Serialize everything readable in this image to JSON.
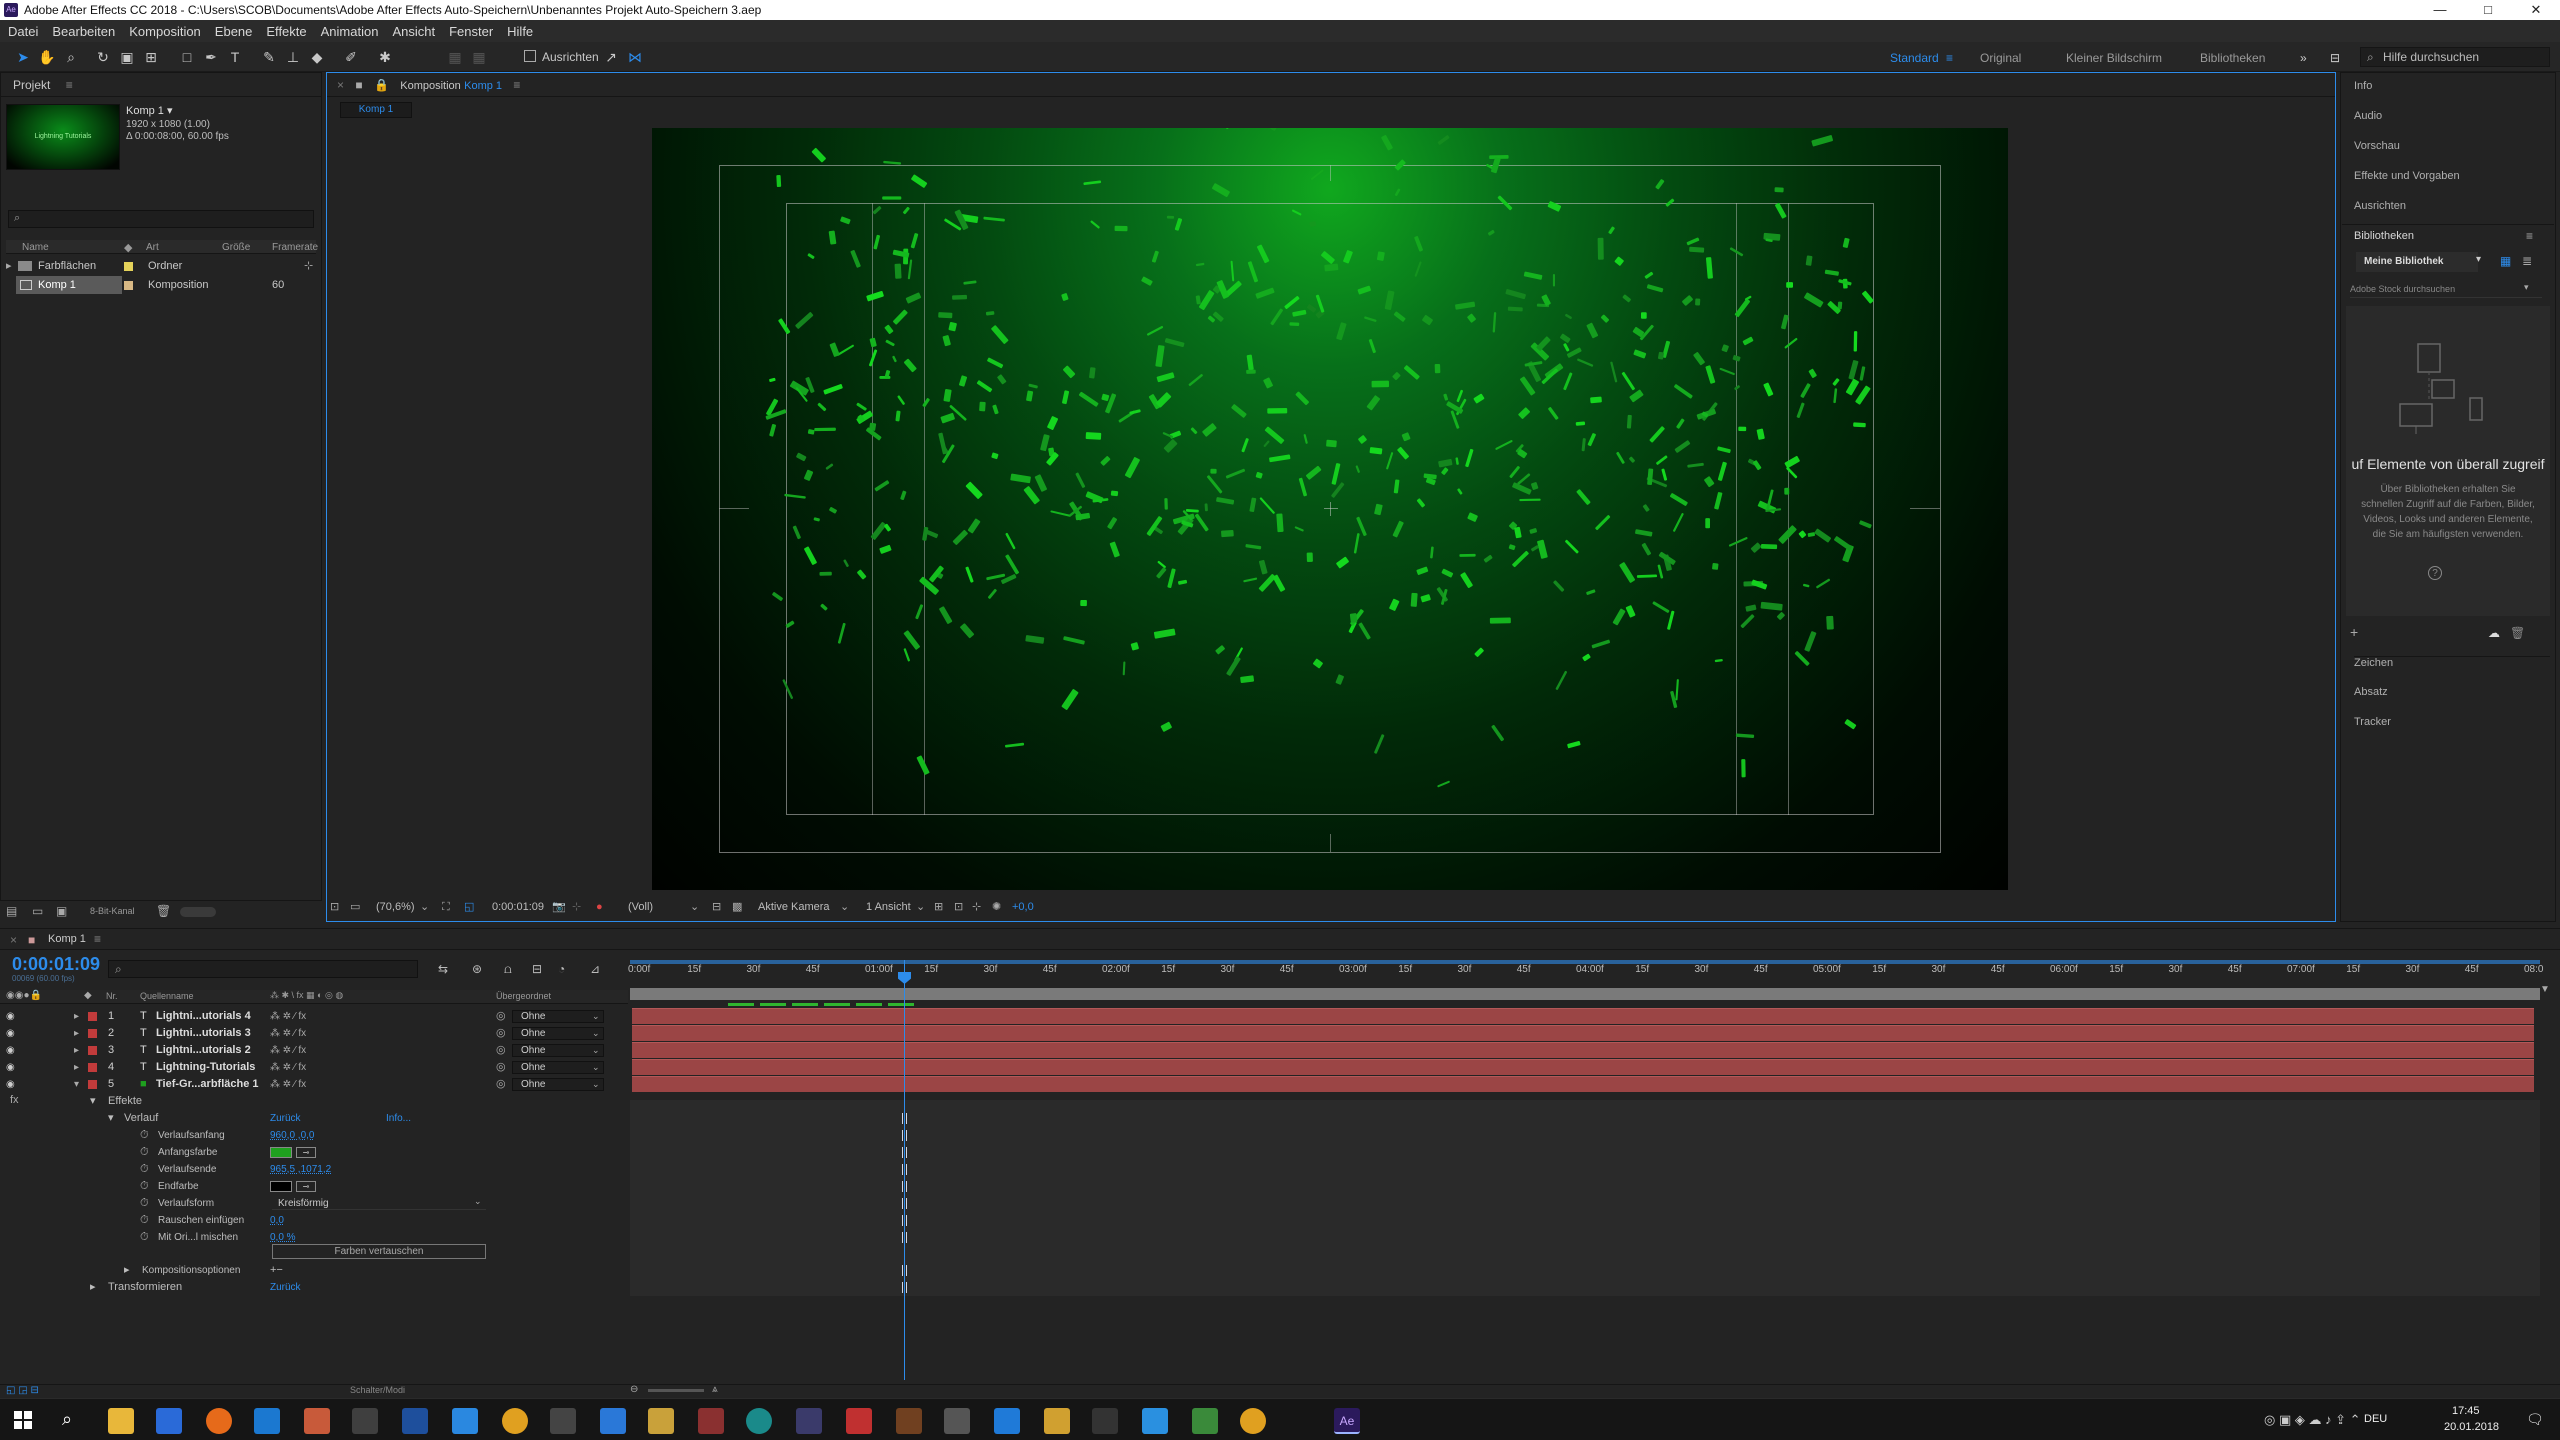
{
  "window": {
    "title": "Adobe After Effects CC 2018 - C:\\Users\\SCOB\\Documents\\Adobe After Effects Auto-Speichern\\Unbenanntes Projekt Auto-Speichern 3.aep",
    "minimize": "—",
    "maximize": "□",
    "close": "✕"
  },
  "menu": [
    "Datei",
    "Bearbeiten",
    "Komposition",
    "Ebene",
    "Effekte",
    "Animation",
    "Ansicht",
    "Fenster",
    "Hilfe"
  ],
  "toolbar": {
    "align_label": "Ausrichten",
    "workspaces": [
      "Standard",
      "Original",
      "Kleiner Bildschirm",
      "Bibliotheken"
    ],
    "active_workspace": "Standard",
    "help_placeholder": "Hilfe durchsuchen"
  },
  "project": {
    "tab": "Projekt",
    "thumb_text": "Lightning Tutorials",
    "comp_name": "Komp 1 ▾",
    "comp_size": "1920 x 1080 (1.00)",
    "comp_duration": "Δ 0:00:08:00, 60.00 fps",
    "columns": [
      "Name",
      "Art",
      "Größe",
      "Framerate"
    ],
    "items": [
      {
        "name": "Farbflächen",
        "type": "Ordner",
        "size": "",
        "fps": ""
      },
      {
        "name": "Komp 1",
        "type": "Komposition",
        "size": "",
        "fps": "60"
      }
    ],
    "footer_bpc": "8-Bit-Kanal"
  },
  "composition": {
    "tab_prefix": "Komposition",
    "tab_name": "Komp 1",
    "sub_tab": "Komp 1",
    "zoom": "(70,6%)",
    "timecode": "0:00:01:09",
    "quality": "(Voll)",
    "camera": "Aktive Kamera",
    "views": "1 Ansicht",
    "exposure": "+0,0"
  },
  "right_panel": {
    "items_top": [
      "Info",
      "Audio",
      "Vorschau",
      "Effekte und Vorgaben",
      "Ausrichten"
    ],
    "libraries_title": "Bibliotheken",
    "library_name": "Meine Bibliothek",
    "stock_search": "Adobe Stock durchsuchen",
    "promo_title": "uf Elemente von überall zugreif",
    "promo_text": "Über Bibliotheken erhalten Sie schnellen Zugriff auf die Farben, Bilder, Videos, Looks und anderen Elemente, die Sie am häufigsten verwenden.",
    "items_bottom": [
      "Zeichen",
      "Absatz",
      "Tracker"
    ]
  },
  "timeline": {
    "tab": "Komp 1",
    "timecode": "0:00:01:09",
    "frame_info": "00069 (60.00 fps)",
    "col_nr": "Nr.",
    "col_source": "Quellenname",
    "col_parent": "Übergeordnet",
    "ruler": [
      "0:00f",
      "15f",
      "30f",
      "45f",
      "01:00f",
      "15f",
      "30f",
      "45f",
      "02:00f",
      "15f",
      "30f",
      "45f",
      "03:00f",
      "15f",
      "30f",
      "45f",
      "04:00f",
      "15f",
      "30f",
      "45f",
      "05:00f",
      "15f",
      "30f",
      "45f",
      "06:00f",
      "15f",
      "30f",
      "45f",
      "07:00f",
      "15f",
      "30f",
      "45f",
      "08:0"
    ],
    "layers": [
      {
        "nr": "1",
        "type": "T",
        "name": "Lightni...utorials 4",
        "parent": "Ohne"
      },
      {
        "nr": "2",
        "type": "T",
        "name": "Lightni...utorials 3",
        "parent": "Ohne"
      },
      {
        "nr": "3",
        "type": "T",
        "name": "Lightni...utorials 2",
        "parent": "Ohne"
      },
      {
        "nr": "4",
        "type": "T",
        "name": "Lightning-Tutorials",
        "parent": "Ohne"
      },
      {
        "nr": "5",
        "type": "■",
        "name": "Tief-Gr...arbfläche 1",
        "parent": "Ohne"
      }
    ],
    "effects": {
      "effects_label": "Effekte",
      "effect_name": "Verlauf",
      "reset": "Zurück",
      "info": "Info...",
      "props": [
        {
          "name": "Verlaufsanfang",
          "value": "960,0 ,0,0"
        },
        {
          "name": "Anfangsfarbe",
          "value": ""
        },
        {
          "name": "Verlaufsende",
          "value": "965,5 ,1071,2"
        },
        {
          "name": "Endfarbe",
          "value": ""
        },
        {
          "name": "Verlaufsform",
          "value": "Kreisförmig"
        },
        {
          "name": "Rauschen einfügen",
          "value": "0,0"
        },
        {
          "name": "Mit Ori...l mischen",
          "value": "0,0 %"
        }
      ],
      "swap_button": "Farben vertauschen",
      "comp_options": "Kompositionsoptionen",
      "transform": "Transformieren",
      "transform_reset": "Zurück"
    },
    "footer_mode": "Schalter/Modi"
  },
  "taskbar": {
    "time": "17:45",
    "date": "20.01.2018",
    "lang": "DEU"
  },
  "colors": {
    "accent": "#2d8ceb",
    "layer_bar": "#9b4545",
    "label_red": "#c23b3b",
    "green": "#1fa01f"
  }
}
